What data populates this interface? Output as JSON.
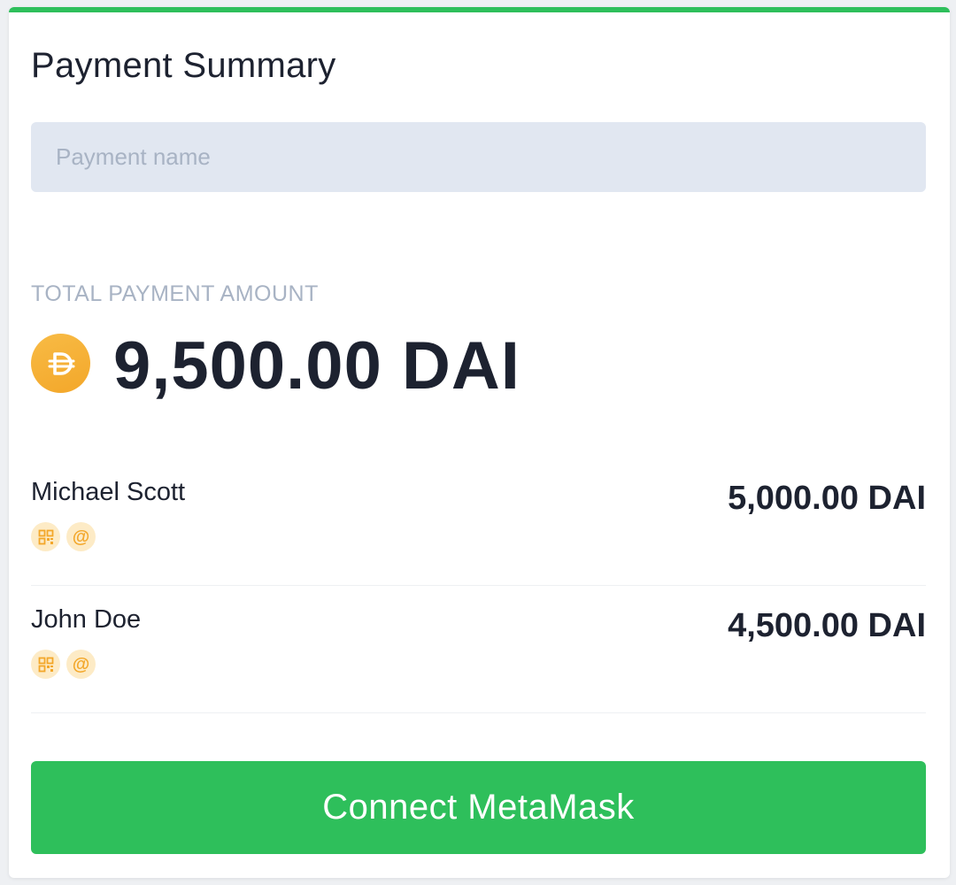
{
  "header": {
    "title": "Payment Summary",
    "accent_color": "#2ebf5b"
  },
  "payment_name": {
    "value": "",
    "placeholder": "Payment name"
  },
  "total": {
    "label": "TOTAL PAYMENT AMOUNT",
    "amount": "9,500.00 DAI",
    "coin_icon": "dai-coin-icon"
  },
  "payees": [
    {
      "name": "Michael Scott",
      "amount": "5,000.00 DAI",
      "icons": [
        "qr-code-icon",
        "at-sign-icon"
      ]
    },
    {
      "name": "John Doe",
      "amount": "4,500.00 DAI",
      "icons": [
        "qr-code-icon",
        "at-sign-icon"
      ]
    }
  ],
  "actions": {
    "connect_label": "Connect MetaMask",
    "connect_color": "#2ebf5b"
  },
  "colors": {
    "coin": "#f3a72a",
    "chip_bg": "#fdebc6",
    "text": "#1d2230",
    "muted": "#a8b3c4",
    "input_bg": "#e1e7f1"
  }
}
